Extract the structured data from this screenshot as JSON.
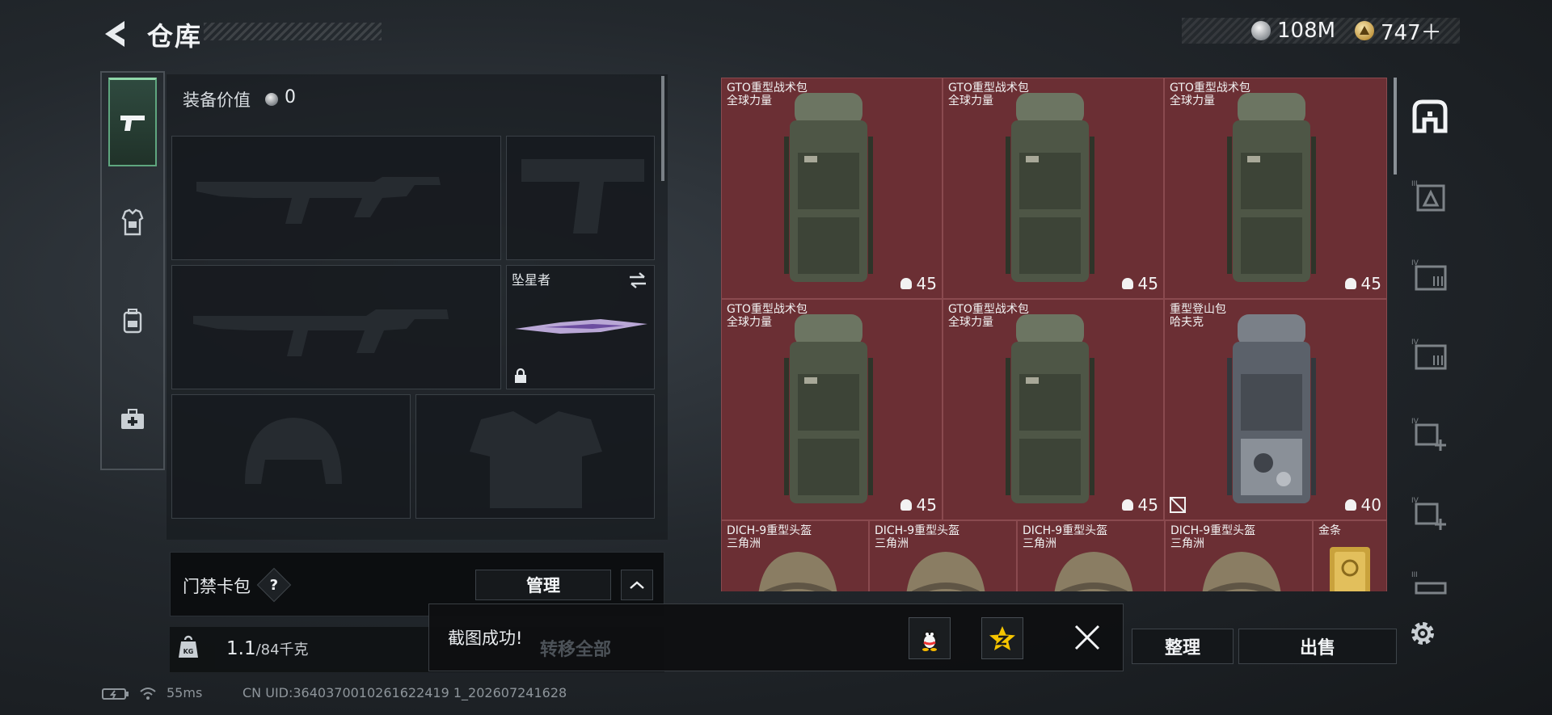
{
  "header": {
    "back_icon": "back-arrow-icon",
    "title": "仓库",
    "currencies": [
      {
        "icon": "silver-coin-icon",
        "value": "108M"
      },
      {
        "icon": "gold-coin-icon",
        "value": "747＋"
      }
    ]
  },
  "left_rail": {
    "items": [
      {
        "name": "weapons",
        "icon": "pistol-icon",
        "active": true
      },
      {
        "name": "armor",
        "icon": "armor-vest-icon",
        "active": false
      },
      {
        "name": "backpack",
        "icon": "backpack-icon",
        "active": false
      },
      {
        "name": "medkit",
        "icon": "medkit-icon",
        "active": false
      }
    ]
  },
  "equipment": {
    "value_label": "装备价值",
    "value": "0",
    "slots": [
      {
        "name": "primary-weapon-slot",
        "label": ""
      },
      {
        "name": "pistol-slot",
        "label": ""
      },
      {
        "name": "secondary-weapon-slot",
        "label": ""
      },
      {
        "name": "melee-slot",
        "label": "坠星者"
      },
      {
        "name": "helmet-slot",
        "label": ""
      },
      {
        "name": "body-armor-slot",
        "label": ""
      }
    ],
    "card_label": "门禁卡包",
    "help": "?",
    "manage_label": "管理",
    "weight_current": "1.1",
    "weight_max": "/84千克"
  },
  "stash": {
    "items": [
      {
        "name": "GTO重型战术包",
        "sub": "全球力量",
        "durability": "45",
        "type": "backpack-green",
        "lockable": false
      },
      {
        "name": "GTO重型战术包",
        "sub": "全球力量",
        "durability": "45",
        "type": "backpack-green",
        "lockable": false
      },
      {
        "name": "GTO重型战术包",
        "sub": "全球力量",
        "durability": "45",
        "type": "backpack-green",
        "lockable": false
      },
      {
        "name": "GTO重型战术包",
        "sub": "全球力量",
        "durability": "45",
        "type": "backpack-green",
        "lockable": false
      },
      {
        "name": "GTO重型战术包",
        "sub": "全球力量",
        "durability": "45",
        "type": "backpack-green",
        "lockable": false
      },
      {
        "name": "重型登山包",
        "sub": "哈夫克",
        "durability": "40",
        "type": "backpack-camo",
        "lockable": true
      },
      {
        "name": "DICH-9重型头盔",
        "sub": "三角洲",
        "durability": "",
        "type": "helmet",
        "lockable": false
      },
      {
        "name": "DICH-9重型头盔",
        "sub": "三角洲",
        "durability": "",
        "type": "helmet",
        "lockable": false
      },
      {
        "name": "DICH-9重型头盔",
        "sub": "三角洲",
        "durability": "",
        "type": "helmet",
        "lockable": false
      },
      {
        "name": "DICH-9重型头盔",
        "sub": "三角洲",
        "durability": "",
        "type": "helmet",
        "lockable": false
      },
      {
        "name": "金条",
        "sub": "",
        "durability": "",
        "type": "gold-bar",
        "lockable": false
      }
    ]
  },
  "right_rail": {
    "items": [
      "stash-main-icon",
      "stash-tab-2-icon",
      "stash-tab-3-icon",
      "stash-tab-4-icon",
      "stash-add-1-icon",
      "stash-add-2-icon",
      "stash-tab-7-icon"
    ]
  },
  "actions": {
    "organize": "整理",
    "sell": "出售",
    "transfer_all": "转移全部"
  },
  "toast": {
    "message": "截图成功!",
    "share_qq_icon": "qq-penguin-icon",
    "share_qzone_icon": "qzone-star-icon",
    "close_icon": "close-icon"
  },
  "status": {
    "ping": "55ms",
    "uid": "CN UID:3640370010261622419 1_202607241628"
  },
  "colors": {
    "stash_cell": "#6b2f34",
    "active_tab": "#5fa67f"
  }
}
